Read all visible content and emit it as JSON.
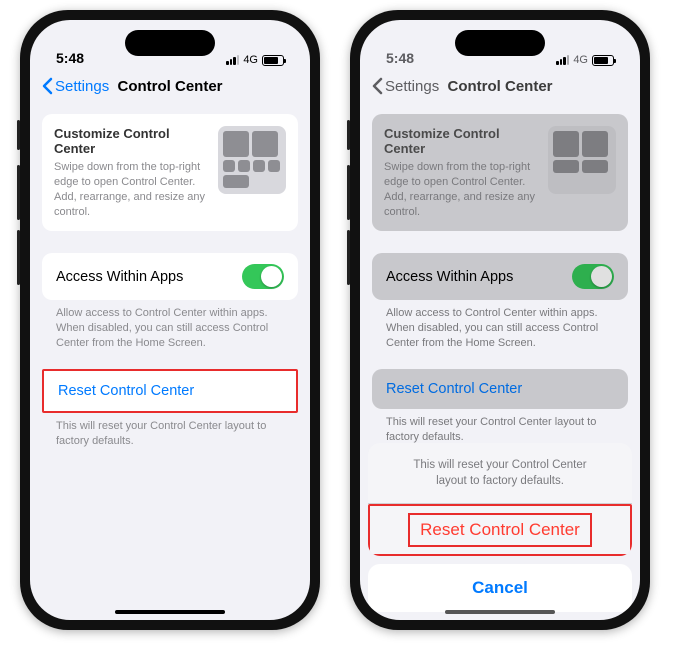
{
  "status": {
    "time": "5:48",
    "network": "4G"
  },
  "nav": {
    "back": "Settings",
    "title": "Control Center"
  },
  "card": {
    "title": "Customize Control Center",
    "desc": "Swipe down from the top-right edge to open Control Center. Add, rearrange, and resize any control."
  },
  "access": {
    "label": "Access Within Apps",
    "footnote": "Allow access to Control Center within apps. When disabled, you can still access Control Center from the Home Screen."
  },
  "reset": {
    "label": "Reset Control Center",
    "footnote": "This will reset your Control Center layout to factory defaults."
  },
  "sheet": {
    "message": "This will reset your Control Center layout to factory defaults.",
    "confirm": "Reset Control Center",
    "cancel": "Cancel"
  }
}
